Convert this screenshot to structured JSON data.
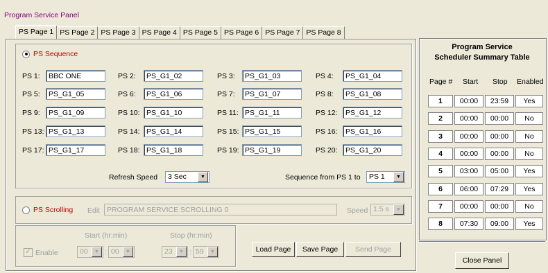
{
  "window": {
    "title": "Program Service Panel"
  },
  "tabs": [
    "PS Page 1",
    "PS Page 2",
    "PS Page 3",
    "PS Page 4",
    "PS Page 5",
    "PS Page 6",
    "PS Page 7",
    "PS Page 8"
  ],
  "sequence": {
    "radio_label": "PS Sequence",
    "fields": [
      {
        "label": "PS 1:",
        "value": "BBC ONE"
      },
      {
        "label": "PS 2:",
        "value": "PS_G1_02"
      },
      {
        "label": "PS 3:",
        "value": "PS_G1_03"
      },
      {
        "label": "PS 4:",
        "value": "PS_G1_04"
      },
      {
        "label": "PS 5:",
        "value": "PS_G1_05"
      },
      {
        "label": "PS 6:",
        "value": "PS_G1_06"
      },
      {
        "label": "PS 7:",
        "value": "PS_G1_07"
      },
      {
        "label": "PS 8:",
        "value": "PS_G1_08"
      },
      {
        "label": "PS 9:",
        "value": "PS_G1_09"
      },
      {
        "label": "PS 10:",
        "value": "PS_G1_10"
      },
      {
        "label": "PS 11:",
        "value": "PS_G1_11"
      },
      {
        "label": "PS 12:",
        "value": "PS_G1_12"
      },
      {
        "label": "PS 13:",
        "value": "PS_G1_13"
      },
      {
        "label": "PS 14:",
        "value": "PS_G1_14"
      },
      {
        "label": "PS 15:",
        "value": "PS_G1_15"
      },
      {
        "label": "PS 16:",
        "value": "PS_G1_16"
      },
      {
        "label": "PS 17:",
        "value": "PS_G1_17"
      },
      {
        "label": "PS 18:",
        "value": "PS_G1_18"
      },
      {
        "label": "PS 19:",
        "value": "PS_G1_19"
      },
      {
        "label": "PS 20:",
        "value": "PS_G1_20"
      }
    ],
    "refresh_label": "Refresh Speed",
    "refresh_value": "3 Sec",
    "sequence_from_label": "Sequence from PS 1 to",
    "sequence_to_value": "PS 1"
  },
  "scrolling": {
    "radio_label": "PS Scrolling",
    "edit_label": "Edit",
    "edit_value": "PROGRAM SERVICE SCROLLING  0",
    "speed_label": "Speed",
    "speed_value": "1.5 s"
  },
  "schedule_controls": {
    "enable_label": "Enable",
    "start_label": "Start (hr:min)",
    "stop_label": "Stop (hr:min)",
    "start_hr": "00",
    "start_min": "00",
    "stop_hr": "23",
    "stop_min": "59",
    "colon": ":",
    "check_mark": "✓"
  },
  "buttons": {
    "load_page": "Load Page",
    "save_page": "Save Page",
    "send_page": "Send Page",
    "close_panel": "Close Panel"
  },
  "scheduler": {
    "title_line1": "Program Service",
    "title_line2": "Scheduler Summary Table",
    "headers": [
      "Page #",
      "Start",
      "Stop",
      "Enabled"
    ],
    "rows": [
      {
        "page": "1",
        "start": "00:00",
        "stop": "23:59",
        "enabled": "Yes"
      },
      {
        "page": "2",
        "start": "00:00",
        "stop": "00:00",
        "enabled": "No"
      },
      {
        "page": "3",
        "start": "00:00",
        "stop": "00:00",
        "enabled": "No"
      },
      {
        "page": "4",
        "start": "00:00",
        "stop": "00:00",
        "enabled": "No"
      },
      {
        "page": "5",
        "start": "03:00",
        "stop": "05:00",
        "enabled": "Yes"
      },
      {
        "page": "6",
        "start": "06:00",
        "stop": "07:29",
        "enabled": "Yes"
      },
      {
        "page": "7",
        "start": "00:00",
        "stop": "00:00",
        "enabled": "No"
      },
      {
        "page": "8",
        "start": "07:30",
        "stop": "09:00",
        "enabled": "Yes"
      }
    ]
  },
  "icons": {
    "dropdown": "chevron-down-icon",
    "radio": "radio-icon",
    "checkbox": "checkbox-icon"
  }
}
